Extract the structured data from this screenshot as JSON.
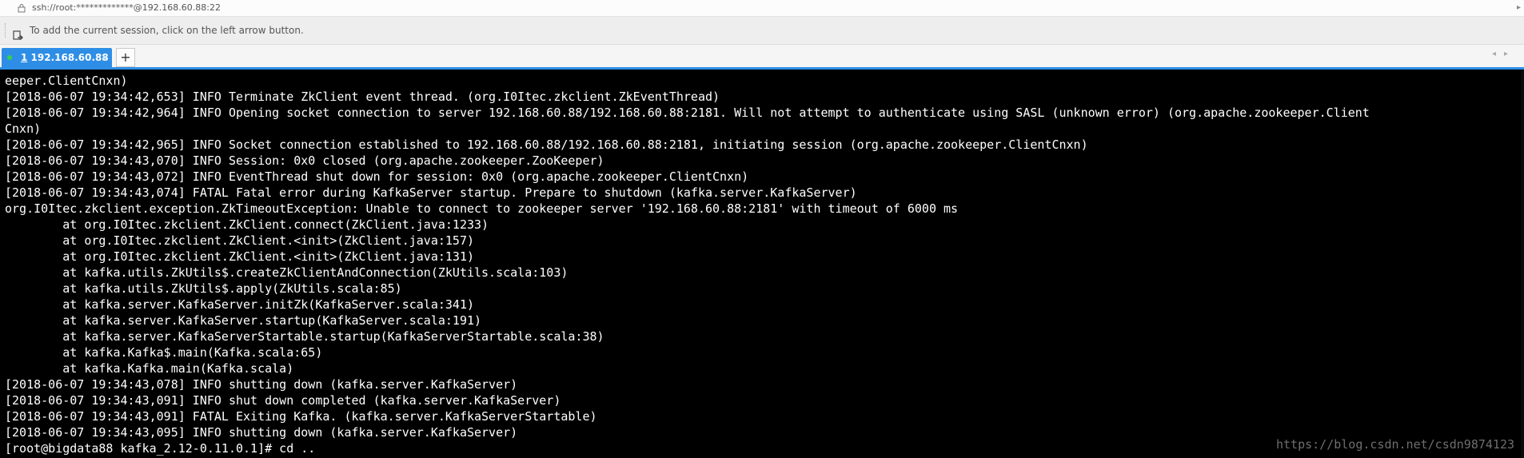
{
  "address_bar": {
    "text": "ssh://root:*************@192.168.60.88:22"
  },
  "hint_bar": {
    "text": "To add the current session, click on the left arrow button."
  },
  "tabs": [
    {
      "index": "1",
      "label": "192.168.60.88",
      "close": "×"
    }
  ],
  "add_tab_label": "+",
  "terminal": {
    "lines": [
      "eeper.ClientCnxn)",
      "[2018-06-07 19:34:42,653] INFO Terminate ZkClient event thread. (org.I0Itec.zkclient.ZkEventThread)",
      "[2018-06-07 19:34:42,964] INFO Opening socket connection to server 192.168.60.88/192.168.60.88:2181. Will not attempt to authenticate using SASL (unknown error) (org.apache.zookeeper.Client",
      "Cnxn)",
      "[2018-06-07 19:34:42,965] INFO Socket connection established to 192.168.60.88/192.168.60.88:2181, initiating session (org.apache.zookeeper.ClientCnxn)",
      "[2018-06-07 19:34:43,070] INFO Session: 0x0 closed (org.apache.zookeeper.ZooKeeper)",
      "[2018-06-07 19:34:43,072] INFO EventThread shut down for session: 0x0 (org.apache.zookeeper.ClientCnxn)",
      "[2018-06-07 19:34:43,074] FATAL Fatal error during KafkaServer startup. Prepare to shutdown (kafka.server.KafkaServer)",
      "org.I0Itec.zkclient.exception.ZkTimeoutException: Unable to connect to zookeeper server '192.168.60.88:2181' with timeout of 6000 ms",
      "        at org.I0Itec.zkclient.ZkClient.connect(ZkClient.java:1233)",
      "        at org.I0Itec.zkclient.ZkClient.<init>(ZkClient.java:157)",
      "        at org.I0Itec.zkclient.ZkClient.<init>(ZkClient.java:131)",
      "        at kafka.utils.ZkUtils$.createZkClientAndConnection(ZkUtils.scala:103)",
      "        at kafka.utils.ZkUtils$.apply(ZkUtils.scala:85)",
      "        at kafka.server.KafkaServer.initZk(KafkaServer.scala:341)",
      "        at kafka.server.KafkaServer.startup(KafkaServer.scala:191)",
      "        at kafka.server.KafkaServerStartable.startup(KafkaServerStartable.scala:38)",
      "        at kafka.Kafka$.main(Kafka.scala:65)",
      "        at kafka.Kafka.main(Kafka.scala)",
      "[2018-06-07 19:34:43,078] INFO shutting down (kafka.server.KafkaServer)",
      "[2018-06-07 19:34:43,091] INFO shut down completed (kafka.server.KafkaServer)",
      "[2018-06-07 19:34:43,091] FATAL Exiting Kafka. (kafka.server.KafkaServerStartable)",
      "[2018-06-07 19:34:43,095] INFO shutting down (kafka.server.KafkaServer)",
      "[root@bigdata88 kafka_2.12-0.11.0.1]# cd .."
    ]
  },
  "watermark": "https://blog.csdn.net/csdn9874123",
  "colors": {
    "accent": "#2e8ee6",
    "terminal_bg": "#000000",
    "terminal_fg": "#ffffff",
    "status_dot": "#35d14b"
  }
}
